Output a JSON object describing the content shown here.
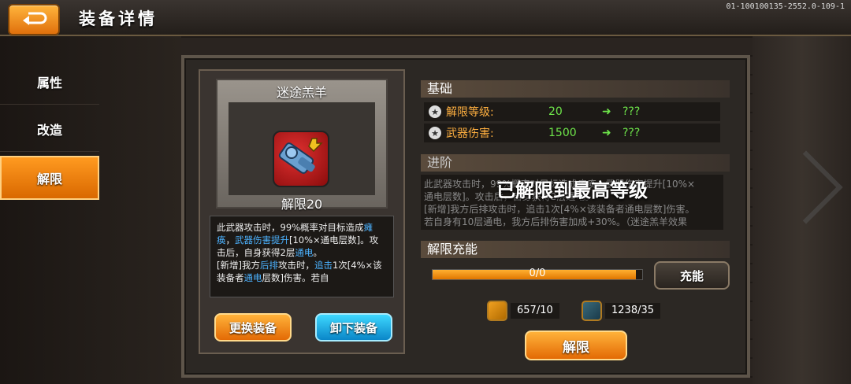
{
  "header": {
    "title": "装备详情",
    "version": "01-100100135-2552.0-109-1"
  },
  "sidebar": {
    "items": [
      {
        "label": "属性"
      },
      {
        "label": "改造"
      },
      {
        "label": "解限",
        "active": true
      }
    ]
  },
  "item": {
    "name": "迷途羔羊",
    "level_label": "解限20",
    "description_parts": [
      {
        "t": "此武器攻击时，99%概率对目标造成"
      },
      {
        "t": "瘫痪",
        "c": "blue"
      },
      {
        "t": "，"
      },
      {
        "t": "武器伤害提升",
        "c": "blue"
      },
      {
        "t": "[10%×通电层数]。攻击后，自身获得2层"
      },
      {
        "t": "通电",
        "c": "blue"
      },
      {
        "t": "。"
      },
      {
        "t": "[新增]我方"
      },
      {
        "t": "后排",
        "c": "blue"
      },
      {
        "t": "攻击时，"
      },
      {
        "t": "追击",
        "c": "blue"
      },
      {
        "t": "1次[4%×该装备者"
      },
      {
        "t": "通电",
        "c": "blue"
      },
      {
        "t": "层数]伤害。若自"
      }
    ]
  },
  "buttons": {
    "replace": "更换装备",
    "unequip": "卸下装备",
    "limit_break": "解限",
    "charge": "充能"
  },
  "basic": {
    "header": "基础",
    "stats": [
      {
        "label": "解限等级:",
        "value": "20",
        "next": "???"
      },
      {
        "label": "武器伤害:",
        "value": "1500",
        "next": "???"
      }
    ]
  },
  "advanced": {
    "header": "进阶",
    "text_lines": [
      "此武器攻击时，99%概率对目标造成瘫痪，武器伤害提升[10%×",
      "通电层数]。攻击后，自身获得2层通电。",
      "[新增]我方后排攻击时，追击1次[4%×该装备者通电层数]伤害。",
      "若自身有10层通电，我方后排伤害加成+30%。（迷途羔羊效果"
    ],
    "overlay": "已解限到最高等级"
  },
  "charge": {
    "header": "解限充能",
    "progress_text": "0/0",
    "progress_fraction": 0.97
  },
  "resources": [
    {
      "icon": "wrench-coin-icon",
      "amount": "657/10"
    },
    {
      "icon": "blueprint-icon",
      "amount": "1238/35"
    }
  ],
  "colors": {
    "accent": "#e36a05",
    "stat_green": "#6ee54a",
    "label_orange": "#ffb040",
    "link_blue": "#4cb2ff"
  }
}
